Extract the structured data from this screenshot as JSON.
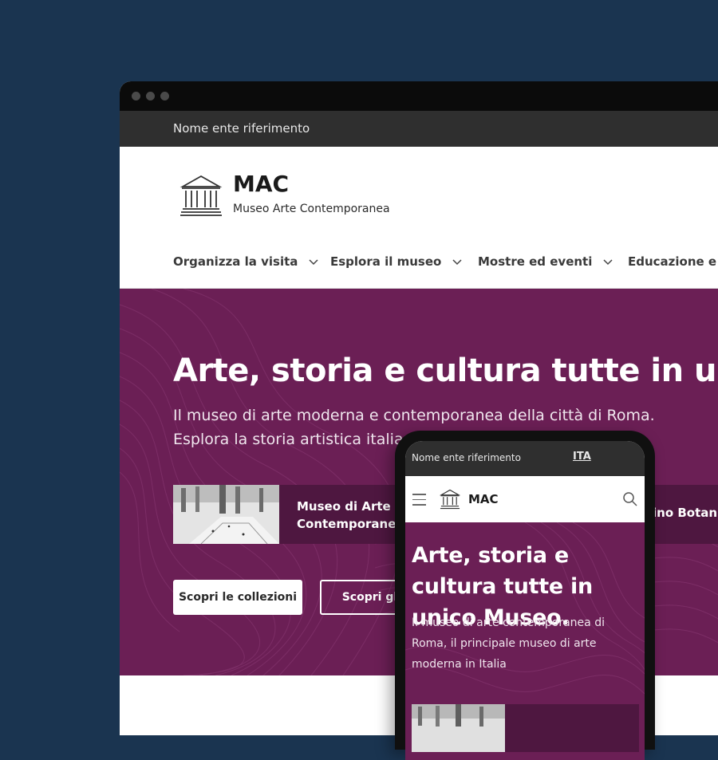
{
  "desktop": {
    "slim_header": "Nome ente riferimento",
    "brand": {
      "title": "MAC",
      "subtitle": "Museo Arte Contemporanea",
      "logo_icon": "museum-building-icon"
    },
    "nav": [
      {
        "label": "Organizza la visita"
      },
      {
        "label": "Esplora il museo"
      },
      {
        "label": "Mostre ed eventi"
      },
      {
        "label": "Educazione e ric"
      }
    ],
    "hero": {
      "title": "Arte, storia e cultura tutte in unico Muse",
      "lead_line1": "Il museo di arte moderna e contemporanea della città di Roma.",
      "lead_line2": "Esplora la storia artistica italian",
      "cards": [
        {
          "title": "Museo di Arte Contemporanea"
        },
        {
          "title": "ino Botanico"
        }
      ],
      "primary_button": "Scopri le collezioni",
      "secondary_button": "Scopri gli a"
    }
  },
  "mobile": {
    "slim_header": "Nome ente riferimento",
    "language": "ITA",
    "brand_title": "MAC",
    "hero_title": "Arte, storia e cultura tutte in unico Museo.",
    "hero_lead": "Il museo di arte contemporanea di Roma, il principale museo di arte moderna in Italia"
  },
  "colors": {
    "background": "#1a3450",
    "hero": "#6b1f55",
    "card": "#4e1740",
    "slim_header": "#2f2f2f"
  }
}
